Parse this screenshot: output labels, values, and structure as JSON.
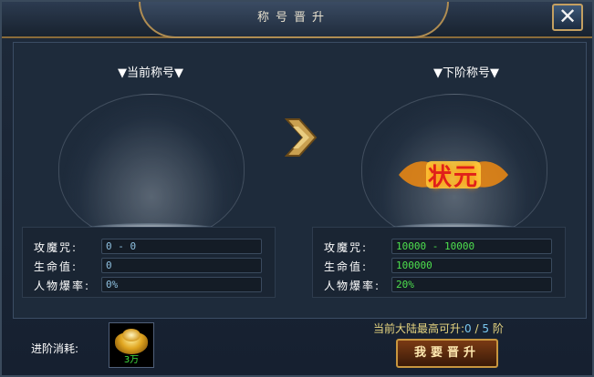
{
  "window": {
    "title": "称号晋升",
    "close_glyph": "✕"
  },
  "current": {
    "heading": "▼当前称号▼",
    "stats": [
      {
        "label": "攻魔咒:",
        "value": "0 - 0"
      },
      {
        "label": "生命值:",
        "value": "0"
      },
      {
        "label": "人物爆率:",
        "value": "0%"
      }
    ]
  },
  "next": {
    "heading": "▼下阶称号▼",
    "title_badge": "状元",
    "stats": [
      {
        "label": "攻魔咒:",
        "value": "10000 - 10000"
      },
      {
        "label": "生命值:",
        "value": "100000"
      },
      {
        "label": "人物爆率:",
        "value": "20%"
      }
    ]
  },
  "footer": {
    "cost_label": "进阶消耗:",
    "cost_item_qty": "3万",
    "limit_prefix": "当前大陆最高可升:",
    "limit_current": "0",
    "limit_sep": " / ",
    "limit_max": "5",
    "limit_suffix": " 阶",
    "promote_label": "我要晋升"
  },
  "colors": {
    "accent_gold": "#c8963e",
    "value_green": "#4ee04e",
    "value_blue": "#8fc1e0"
  },
  "icons": {
    "arrow": "chevron-right-icon",
    "close": "close-icon",
    "ingot": "gold-ingot-icon"
  }
}
